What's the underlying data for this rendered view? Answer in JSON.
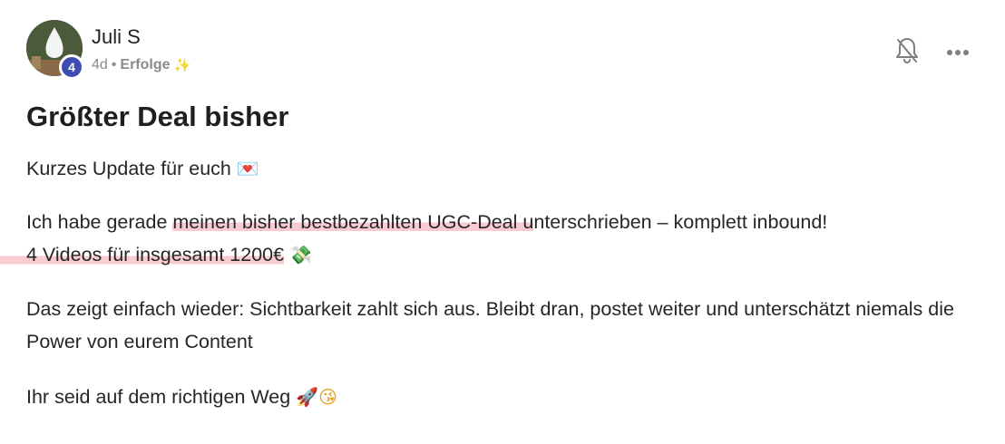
{
  "author": {
    "name": "Juli S",
    "level": "4",
    "time": "4d",
    "separator": "•",
    "category": "Erfolge",
    "category_emoji": "✨"
  },
  "post": {
    "title": "Größter Deal bisher",
    "p1_text": "Kurzes Update für euch",
    "p1_emoji": "💌",
    "p2_before": "Ich habe gerade ",
    "p2_highlight": "meinen bisher bestbezahlten UGC-Deal u",
    "p2_after": "nterschrieben – komplett inbound!",
    "p2_line2_highlight": "4 Videos für insgesamt 1200€",
    "p2_line2_emoji": "💸",
    "p3_text": "Das zeigt einfach wieder: Sichtbarkeit zahlt sich aus. Bleibt dran, postet weiter und unterschätzt niemals die Power von eurem Content",
    "p4_text": "Ihr seid auf dem richtigen Weg",
    "p4_emoji_1": "🚀",
    "p4_emoji_2": "😘"
  },
  "icons": {
    "bell": "bell-off-icon",
    "more": "more-horizontal-icon"
  },
  "colors": {
    "badge": "#3f4db3",
    "highlight": "#f1a0aa",
    "muted": "#8b8b8b"
  }
}
